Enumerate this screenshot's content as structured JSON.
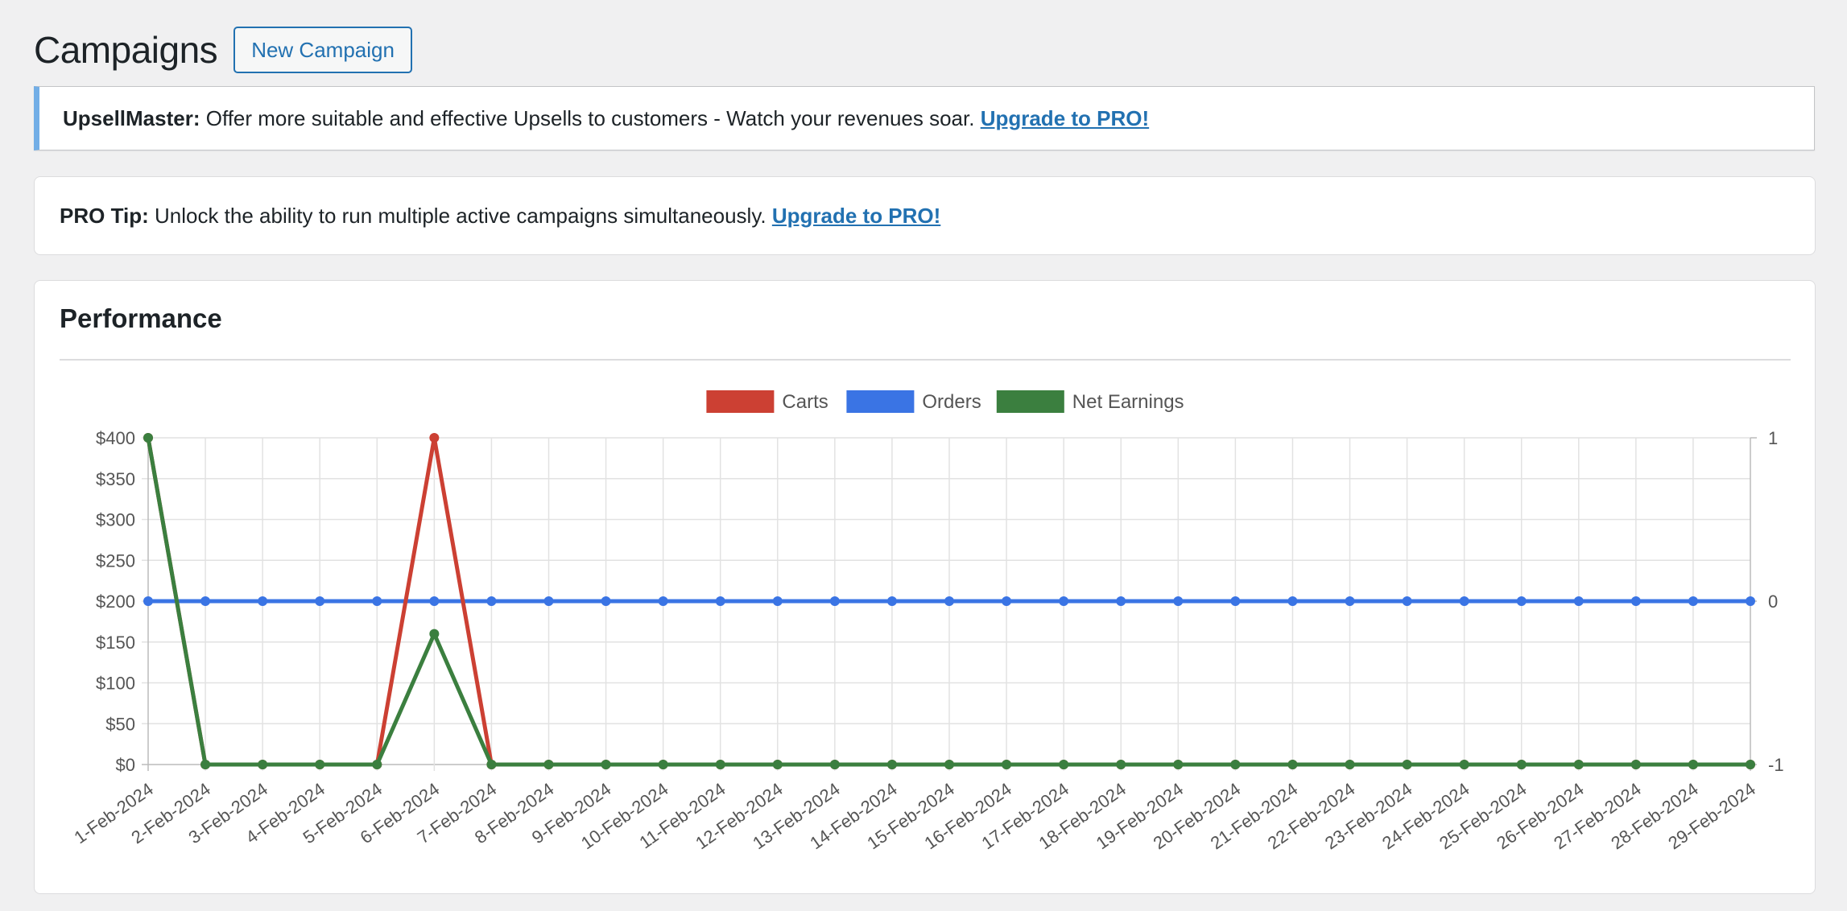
{
  "header": {
    "title": "Campaigns",
    "new_button": "New Campaign"
  },
  "notice": {
    "brand": "UpsellMaster:",
    "message": " Offer more suitable and effective Upsells to customers - Watch your revenues soar. ",
    "link": "Upgrade to PRO!",
    "accent_color": "#72aee6"
  },
  "tip": {
    "label": "PRO Tip:",
    "message": " Unlock the ability to run multiple active campaigns simultaneously. ",
    "link": "Upgrade to PRO!"
  },
  "performance": {
    "title": "Performance"
  },
  "chart_data": {
    "type": "line",
    "title": "",
    "xlabel": "",
    "ylabel": "",
    "legend_position": "top-center",
    "grid": true,
    "categories": [
      "1-Feb-2024",
      "2-Feb-2024",
      "3-Feb-2024",
      "4-Feb-2024",
      "5-Feb-2024",
      "6-Feb-2024",
      "7-Feb-2024",
      "8-Feb-2024",
      "9-Feb-2024",
      "10-Feb-2024",
      "11-Feb-2024",
      "12-Feb-2024",
      "13-Feb-2024",
      "14-Feb-2024",
      "15-Feb-2024",
      "16-Feb-2024",
      "17-Feb-2024",
      "18-Feb-2024",
      "19-Feb-2024",
      "20-Feb-2024",
      "21-Feb-2024",
      "22-Feb-2024",
      "23-Feb-2024",
      "24-Feb-2024",
      "25-Feb-2024",
      "26-Feb-2024",
      "27-Feb-2024",
      "28-Feb-2024",
      "29-Feb-2024"
    ],
    "y_left": {
      "range": [
        0,
        400
      ],
      "ticks": [
        0,
        50,
        100,
        150,
        200,
        250,
        300,
        350,
        400
      ],
      "tick_labels": [
        "$0",
        "$50",
        "$100",
        "$150",
        "$200",
        "$250",
        "$300",
        "$350",
        "$400"
      ]
    },
    "y_right": {
      "range": [
        -1,
        1
      ],
      "ticks": [
        -1,
        0,
        1
      ],
      "tick_labels": [
        "-1",
        "0",
        "1"
      ]
    },
    "series": [
      {
        "name": "Carts",
        "color": "#cc4033",
        "axis": "left",
        "values": [
          400,
          0,
          0,
          0,
          0,
          400,
          0,
          0,
          0,
          0,
          0,
          0,
          0,
          0,
          0,
          0,
          0,
          0,
          0,
          0,
          0,
          0,
          0,
          0,
          0,
          0,
          0,
          0,
          0
        ]
      },
      {
        "name": "Orders",
        "color": "#3a74e4",
        "axis": "right",
        "values": [
          0,
          0,
          0,
          0,
          0,
          0,
          0,
          0,
          0,
          0,
          0,
          0,
          0,
          0,
          0,
          0,
          0,
          0,
          0,
          0,
          0,
          0,
          0,
          0,
          0,
          0,
          0,
          0,
          0
        ]
      },
      {
        "name": "Net Earnings",
        "color": "#3b7f3f",
        "axis": "left",
        "values": [
          400,
          0,
          0,
          0,
          0,
          160,
          0,
          0,
          0,
          0,
          0,
          0,
          0,
          0,
          0,
          0,
          0,
          0,
          0,
          0,
          0,
          0,
          0,
          0,
          0,
          0,
          0,
          0,
          0
        ]
      }
    ]
  }
}
